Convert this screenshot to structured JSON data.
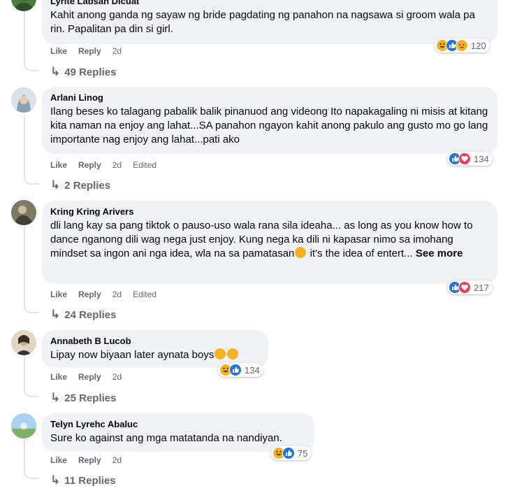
{
  "colors": {
    "bubble": "#f0f2f5",
    "meta": "#65676b",
    "like": "#1b74e4",
    "love": "#f33e58",
    "haha": "#f7b125"
  },
  "actions": {
    "like": "Like",
    "reply": "Reply",
    "edited": "Edited"
  },
  "comments": [
    {
      "author": "Lyrite Labsan Dicuat",
      "text": "Kahit anong ganda ng sayaw ng bride pagdating ng panahon na nagsawa si groom wala pa rin. Papalitan pa din si girl.",
      "time": "2d",
      "reaction_icons": [
        "haha-icon",
        "like-icon",
        "sad-icon"
      ],
      "reaction_count": "120",
      "replies": "49 Replies"
    },
    {
      "author": "Arlani Linog",
      "text": "Ilang beses ko talagang pabalik balik pinanuod ang videong Ito napakagaling ni misis at kitang kita naman na enjoy ang lahat...SA panahon ngayon kahit anong pakulo ang gusto mo go lang importante nag enjoy ang lahat...pati ako",
      "time": "2d",
      "edited": true,
      "reaction_icons": [
        "like-icon",
        "love-icon"
      ],
      "reaction_count": "134",
      "replies": "2 Replies"
    },
    {
      "author": "Kring Kring Arivers",
      "text": "dli lang kay sa pang tiktok o pauso-uso wala rana sila ideaha... as long as you know how to dance nganong dili wag nega just enjoy. Kung nega ka dili ni kapasar nimo sa imohang mindset sa ingon ani nga idea, wla na sa pamatasan",
      "text_after": " it's the idea of entert...",
      "see_more": "See more",
      "time": "2d",
      "edited": true,
      "reaction_icons": [
        "like-icon",
        "love-icon"
      ],
      "reaction_count": "217",
      "replies": "24 Replies"
    },
    {
      "author": "Annabeth B Lucob",
      "text": "Lipay now biyaan later aynata boys",
      "time": "2d",
      "reaction_icons": [
        "haha-icon",
        "like-icon"
      ],
      "reaction_count": "134",
      "replies": "25 Replies"
    },
    {
      "author": "Telyn Lyrehc Abaluc",
      "text": "Sure ko against ang mga matatanda na nandiyan.",
      "time": "2d",
      "reaction_icons": [
        "haha-icon",
        "like-icon"
      ],
      "reaction_count": "75",
      "replies": "11 Replies"
    }
  ]
}
